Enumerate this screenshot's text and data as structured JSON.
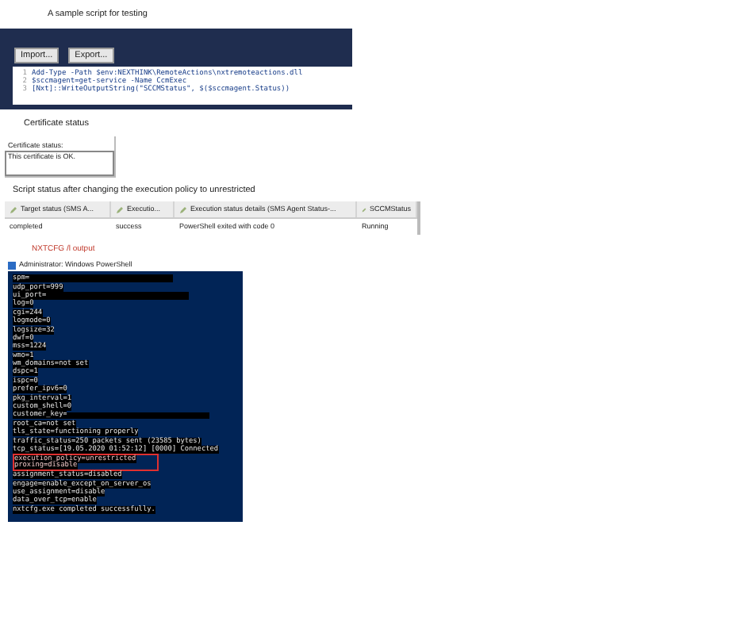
{
  "script_section": {
    "caption": "A sample script for testing",
    "buttons": [
      "Import...",
      "Export..."
    ],
    "code_lines": [
      {
        "number": "1",
        "text": "Add-Type -Path $env:NEXTHINK\\RemoteActions\\nxtremoteactions.dll"
      },
      {
        "number": "2",
        "text": "$sccmagent=get-service -Name CcmExec"
      },
      {
        "number": "3",
        "text": "[Nxt]::WriteOutputString(\"SCCMStatus\", $($sccmagent.Status))"
      }
    ]
  },
  "certificate_section": {
    "caption": "Certificate status",
    "label": "Certificate status:",
    "value": "This certificate is OK."
  },
  "status_section": {
    "caption": "Script status after changing the execution policy to unrestricted",
    "columns": [
      "Target status (SMS A...",
      "Executio...",
      "Execution status details (SMS Agent Status-...",
      "SCCMStatus"
    ],
    "rows": [
      [
        "completed",
        "success",
        "PowerShell exited with code 0",
        "Running"
      ]
    ]
  },
  "output_section": {
    "caption": "NXTCFG /l output",
    "window_title": "Administrator: Windows PowerShell",
    "lines": [
      {
        "text": "spm=",
        "redacted": true,
        "highlighted": false
      },
      {
        "text": "udp_port=999",
        "redacted": false,
        "highlighted": false
      },
      {
        "text": "ui_port=",
        "redacted": true,
        "highlighted": false
      },
      {
        "text": "log=0",
        "redacted": false,
        "highlighted": false
      },
      {
        "text": "cgi=244",
        "redacted": false,
        "highlighted": false
      },
      {
        "text": "logmode=0",
        "redacted": false,
        "highlighted": false
      },
      {
        "text": "logsize=32",
        "redacted": false,
        "highlighted": false
      },
      {
        "text": "dwf=0",
        "redacted": false,
        "highlighted": false
      },
      {
        "text": "mss=1224",
        "redacted": false,
        "highlighted": false
      },
      {
        "text": "wmo=1",
        "redacted": false,
        "highlighted": false
      },
      {
        "text": "wm_domains=not set",
        "redacted": false,
        "highlighted": false
      },
      {
        "text": "dspc=1",
        "redacted": false,
        "highlighted": false
      },
      {
        "text": "ispc=0",
        "redacted": false,
        "highlighted": false
      },
      {
        "text": "prefer_ipv6=0",
        "redacted": false,
        "highlighted": false
      },
      {
        "text": "pkg_interval=1",
        "redacted": false,
        "highlighted": false
      },
      {
        "text": "custom_shell=0",
        "redacted": false,
        "highlighted": false
      },
      {
        "text": "customer_key=",
        "redacted": true,
        "highlighted": false
      },
      {
        "text": "root_ca=not set",
        "redacted": false,
        "highlighted": false
      },
      {
        "text": "tls_state=functioning properly",
        "redacted": false,
        "highlighted": false
      },
      {
        "text": "traffic_status=250 packets sent (23585 bytes)",
        "redacted": false,
        "highlighted": false
      },
      {
        "text": "tcp_status=[19.05.2020 01:52:12] [0000] Connected",
        "redacted": false,
        "highlighted": false
      },
      {
        "text": "execution_policy=unrestricted",
        "redacted": false,
        "highlighted": true
      },
      {
        "text": "proxing=disable",
        "redacted": false,
        "highlighted": true
      },
      {
        "text": "assignment_status=disabled",
        "redacted": false,
        "highlighted": false
      },
      {
        "text": "engage=enable_except_on_server_os",
        "redacted": false,
        "highlighted": false
      },
      {
        "text": "use_assignment=disable",
        "redacted": false,
        "highlighted": false
      },
      {
        "text": "data_over_tcp=enable",
        "redacted": false,
        "highlighted": false
      },
      {
        "text": "nxtcfg.exe completed successfully.",
        "redacted": false,
        "highlighted": false
      }
    ]
  }
}
